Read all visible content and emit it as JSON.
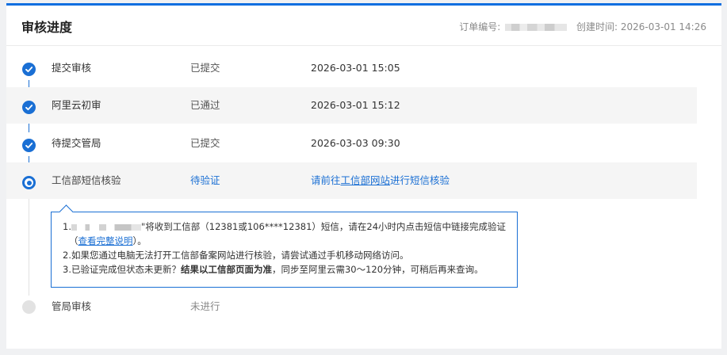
{
  "header": {
    "title": "审核进度",
    "order_label": "订单编号:",
    "created_label": "创建时间:",
    "created_time": "2026-03-01 14:26"
  },
  "steps": [
    {
      "name": "提交审核",
      "status": "已提交",
      "time": "2026-03-01 15:05",
      "state": "done"
    },
    {
      "name": "阿里云初审",
      "status": "已通过",
      "time": "2026-03-01 15:12",
      "state": "done"
    },
    {
      "name": "待提交管局",
      "status": "已提交",
      "time": "2026-03-03 09:30",
      "state": "done"
    },
    {
      "name": "工信部短信核验",
      "status": "待验证",
      "action_prefix": "请前往",
      "action_link": "工信部网站",
      "action_suffix": "进行短信核验",
      "state": "current"
    },
    {
      "name": "管局审核",
      "status": "未进行",
      "state": "pending"
    }
  ],
  "tip": {
    "line1_prefix": "1.",
    "line1_text": "\"将收到工信部（12381或106****12381）短信，请在24小时内点击短信中链接完成验证",
    "line1b_open": "（",
    "line1b_link": "查看完整说明",
    "line1b_close": "）。",
    "line2": "2.如果您通过电脑无法打开工信部备案网站进行核验，请尝试通过手机移动网络访问。",
    "line3_prefix": "3.已验证完成但状态未更新？",
    "line3_bold": "结果以工信部页面为准",
    "line3_suffix": "，同步至阿里云需30～120分钟，可稍后再来查询。"
  },
  "colors": {
    "accent": "#1a6fd4",
    "top_border": "#0f6fe0",
    "row_shade": "#f5f5f5",
    "pending": "#e2e2e2"
  }
}
